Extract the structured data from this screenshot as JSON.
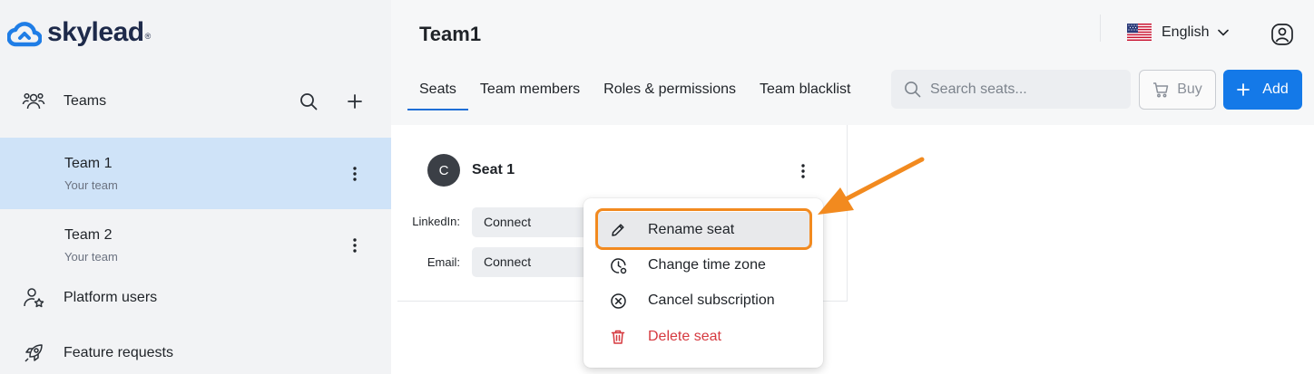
{
  "app": {
    "logo_text": "skylead",
    "logo_mark": "®"
  },
  "sidebar": {
    "teams_label": "Teams",
    "teams": [
      {
        "name": "Team 1",
        "subtitle": "Your team",
        "active": true
      },
      {
        "name": "Team 2",
        "subtitle": "Your team",
        "active": false
      }
    ],
    "platform_users_label": "Platform users",
    "feature_requests_label": "Feature requests"
  },
  "header": {
    "title": "Team1",
    "language": "English"
  },
  "tabs": [
    {
      "label": "Seats",
      "active": true
    },
    {
      "label": "Team members",
      "active": false
    },
    {
      "label": "Roles & permissions",
      "active": false
    },
    {
      "label": "Team blacklist",
      "active": false
    }
  ],
  "search": {
    "placeholder": "Search seats..."
  },
  "buttons": {
    "buy": "Buy",
    "add": "Add"
  },
  "seat": {
    "avatar_letter": "C",
    "name": "Seat 1",
    "linkedin_label": "LinkedIn:",
    "linkedin_value": "Connect",
    "email_label": "Email:",
    "email_value": "Connect"
  },
  "menu": {
    "items": [
      {
        "label": "Rename seat",
        "icon": "pencil-icon"
      },
      {
        "label": "Change time zone",
        "icon": "clock-icon"
      },
      {
        "label": "Cancel subscription",
        "icon": "circle-x-icon"
      },
      {
        "label": "Delete seat",
        "icon": "trash-icon"
      }
    ]
  },
  "colors": {
    "accent": "#1479e8",
    "active_team_bg": "#cfe3f8",
    "danger": "#d6393f",
    "annotation": "#f28a1f",
    "logo_blue": "#1f7de6"
  }
}
